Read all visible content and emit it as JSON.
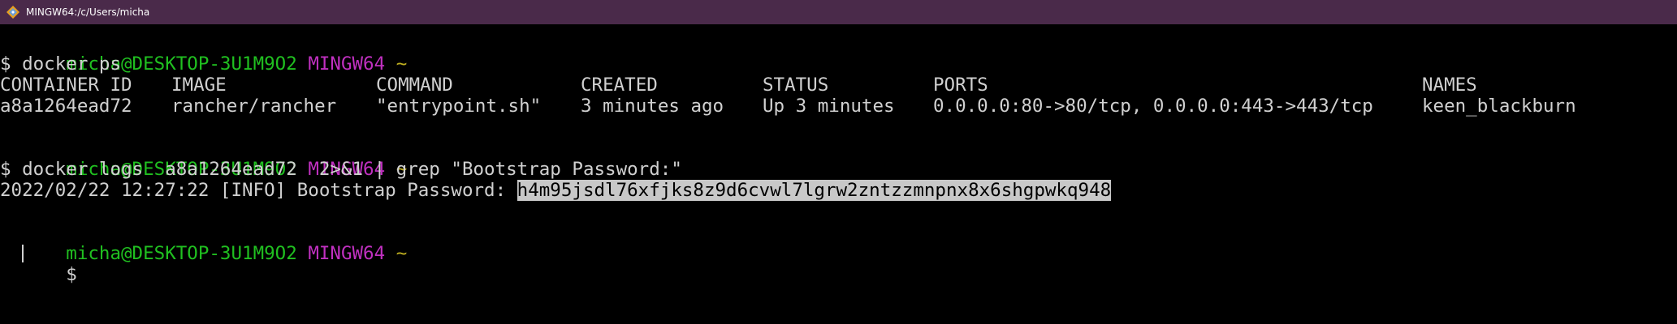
{
  "window": {
    "title": "MINGW64:/c/Users/micha",
    "icon": "mingw-terminal-icon"
  },
  "colors": {
    "titlebar_bg": "#4a2a4a",
    "terminal_bg": "#000000",
    "prompt_user": "#20c020",
    "prompt_env": "#c030c0",
    "prompt_path": "#c0b020",
    "text": "#d0d0d0",
    "selection_bg": "#c8c8c8"
  },
  "prompt": {
    "user_host": "micha@DESKTOP-3U1M9O2",
    "env": "MINGW64",
    "path": "~"
  },
  "block1": {
    "command": "$ docker ps",
    "headers": {
      "container_id": "CONTAINER ID",
      "image": "IMAGE",
      "command": "COMMAND",
      "created": "CREATED",
      "status": "STATUS",
      "ports": "PORTS",
      "names": "NAMES"
    },
    "row": {
      "container_id": "a8a1264ead72",
      "image": "rancher/rancher",
      "command": "\"entrypoint.sh\"",
      "created": "3 minutes ago",
      "status": "Up 3 minutes",
      "ports": "0.0.0.0:80->80/tcp, 0.0.0.0:443->443/tcp",
      "names": "keen_blackburn"
    }
  },
  "block2": {
    "command": "$ docker logs  a8a1264ead72  2>&1 | grep \"Bootstrap Password:\"",
    "output_prefix": "2022/02/22 12:27:22 [INFO] Bootstrap Password: ",
    "password": "h4m95jsdl76xfjks8z9d6cvwl7lgrw2zntzzmnpnx8x6shgpwkq948"
  },
  "block3": {
    "prompt_symbol": "$ "
  }
}
